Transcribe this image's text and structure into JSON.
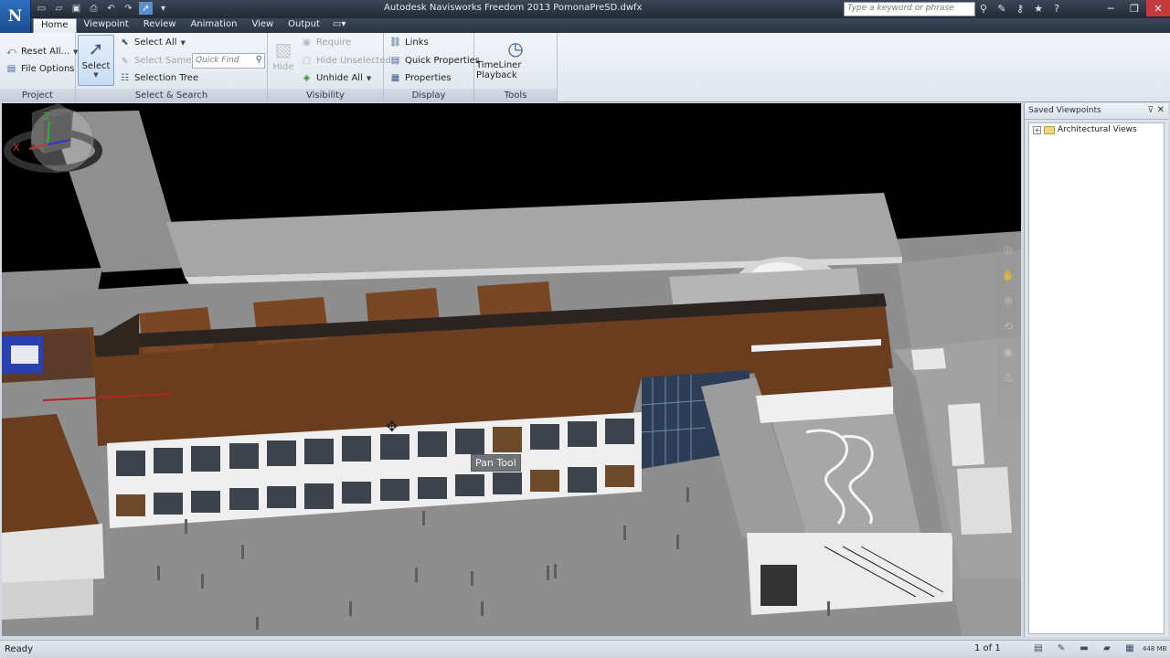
{
  "titlebar": {
    "app_letter": "N",
    "title": "Autodesk Navisworks Freedom 2013    PomonaPreSD.dwfx",
    "search_placeholder": "Type a keyword or phrase",
    "quick_access_icons": [
      "new-icon",
      "open-icon",
      "save-icon",
      "print-icon",
      "undo-icon",
      "redo-icon",
      "select-icon",
      "customize-icon"
    ]
  },
  "tabs": [
    {
      "label": "Home",
      "active": true
    },
    {
      "label": "Viewpoint",
      "active": false
    },
    {
      "label": "Review",
      "active": false
    },
    {
      "label": "Animation",
      "active": false
    },
    {
      "label": "View",
      "active": false
    },
    {
      "label": "Output",
      "active": false
    }
  ],
  "ribbon": {
    "project": {
      "title": "Project",
      "reset_all": "Reset All...",
      "file_options": "File Options"
    },
    "select_search": {
      "title": "Select & Search",
      "select": "Select",
      "select_all": "Select All",
      "select_same": "Select Same",
      "selection_tree": "Selection Tree",
      "quick_find_placeholder": "Quick Find"
    },
    "visibility": {
      "title": "Visibility",
      "hide": "Hide",
      "require": "Require",
      "hide_unselected": "Hide Unselected",
      "unhide_all": "Unhide All"
    },
    "display": {
      "title": "Display",
      "links": "Links",
      "quick_properties": "Quick Properties",
      "properties": "Properties"
    },
    "tools": {
      "title": "Tools",
      "timeliner_playback": "TimeLiner Playback"
    }
  },
  "viewport": {
    "tooltip": "Pan Tool",
    "compass": {
      "east": "E",
      "north": "N"
    }
  },
  "saved_viewpoints": {
    "title": "Saved Viewpoints",
    "items": [
      {
        "label": "Architectural Views",
        "expanded": false
      }
    ]
  },
  "statusbar": {
    "status": "Ready",
    "page": "1 of 1",
    "memory": "448 MB"
  },
  "colors": {
    "roof": "#6b3d1f",
    "ribbon_bg": "#e6ebf2",
    "title_bg": "#2f3846"
  }
}
